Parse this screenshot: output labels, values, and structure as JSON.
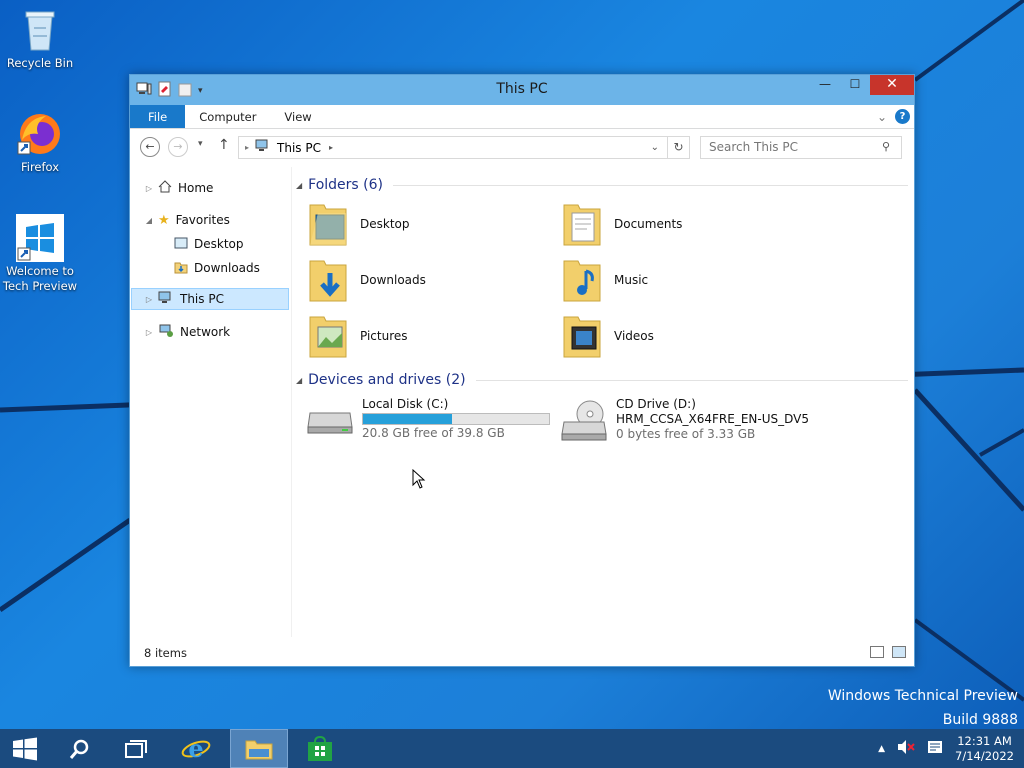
{
  "desktop": {
    "icons": [
      {
        "label": "Recycle Bin"
      },
      {
        "label": "Firefox"
      },
      {
        "label": "Welcome to Tech Preview"
      }
    ],
    "watermark": {
      "line1": "Windows Technical Preview",
      "line2": "Build 9888"
    }
  },
  "window": {
    "title": "This PC",
    "controls": {
      "minimize": "—",
      "maximize": "☐",
      "close": "✕"
    },
    "ribbon": {
      "tabs": [
        "File",
        "Computer",
        "View"
      ],
      "help": "?"
    },
    "address": {
      "location": "This PC"
    },
    "search": {
      "placeholder": "Search This PC"
    },
    "nav": {
      "home": "Home",
      "favorites": "Favorites",
      "desktop": "Desktop",
      "downloads": "Downloads",
      "this_pc": "This PC",
      "network": "Network"
    },
    "folders_header": "Folders (6)",
    "folders": [
      {
        "label": "Desktop",
        "icon": "desktop-folder-icon"
      },
      {
        "label": "Documents",
        "icon": "documents-folder-icon"
      },
      {
        "label": "Downloads",
        "icon": "downloads-folder-icon"
      },
      {
        "label": "Music",
        "icon": "music-folder-icon"
      },
      {
        "label": "Pictures",
        "icon": "pictures-folder-icon"
      },
      {
        "label": "Videos",
        "icon": "videos-folder-icon"
      }
    ],
    "devices_header": "Devices and drives (2)",
    "drives": [
      {
        "name": "Local Disk (C:)",
        "detail": "",
        "free": "20.8 GB free of 39.8 GB",
        "used_fraction": 0.48
      },
      {
        "name": "CD Drive (D:)",
        "detail": "HRM_CCSA_X64FRE_EN-US_DV5",
        "free": "0 bytes free of 3.33 GB"
      }
    ],
    "status": "8 items"
  },
  "taskbar": {
    "time": "12:31 AM",
    "date": "7/14/2022"
  },
  "colors": {
    "accent": "#1979ca",
    "selection": "#cce8ff",
    "close": "#c7342b",
    "drive_bar": "#26a0da"
  }
}
